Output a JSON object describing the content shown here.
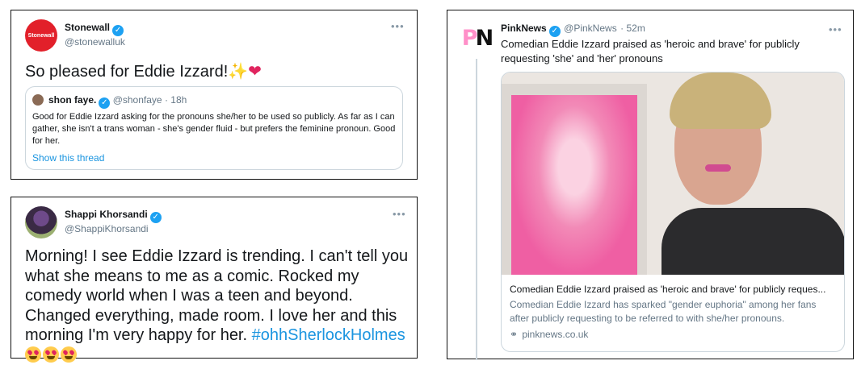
{
  "tweets": {
    "stonewall": {
      "avatar_text": "Stonewall",
      "name": "Stonewall",
      "handle": "@stonewalluk",
      "text": "So pleased for Eddie Izzard!",
      "quote": {
        "name": "shon faye.",
        "handle": "@shonfaye",
        "time": "· 18h",
        "text": "Good for Eddie Izzard asking for the pronouns she/her to be used so publicly. As far as I can gather, she isn't a trans woman - she's gender fluid - but prefers the feminine pronoun. Good for her.",
        "link": "Show this thread"
      }
    },
    "shappi": {
      "name": "Shappi Khorsandi",
      "handle": "@ShappiKhorsandi",
      "text": "Morning! I see Eddie Izzard is trending. I can't tell you what she means to me as a comic. Rocked my comedy world when I was a teen and beyond. Changed everything, made room. I love her and this morning I'm very happy for her. ",
      "hashtag": "#ohhSherlockHolmes"
    },
    "pinknews": {
      "logo_p": "P",
      "logo_n": "N",
      "name": "PinkNews",
      "handle": "@PinkNews",
      "time": "· 52m",
      "text": "Comedian Eddie Izzard praised as 'heroic and brave' for publicly requesting 'she' and 'her' pronouns",
      "card": {
        "title": "Comedian Eddie Izzard praised as 'heroic and brave' for publicly reques...",
        "description": "Comedian Eddie Izzard has sparked \"gender euphoria\" among her fans after publicly requesting to be referred to with she/her pronouns.",
        "domain": "pinknews.co.uk"
      }
    }
  },
  "icons": {
    "more": "•••",
    "verified": "✓",
    "sparkles": "✨",
    "heart": "❤",
    "link": "🔗"
  },
  "colors": {
    "accent": "#1b95e0",
    "verified": "#1da1f2",
    "stonewall_red": "#e2202a",
    "pink": "#ff8fc8"
  }
}
